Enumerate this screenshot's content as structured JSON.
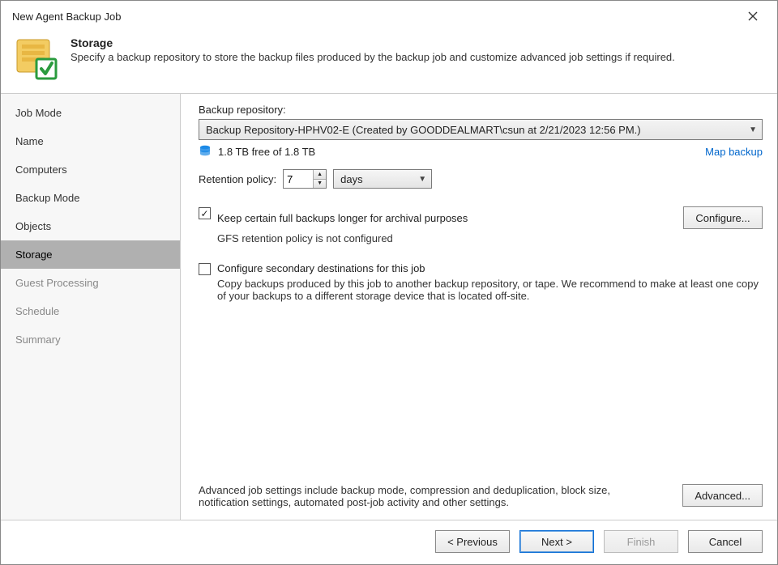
{
  "window": {
    "title": "New Agent Backup Job"
  },
  "header": {
    "title": "Storage",
    "subtitle": "Specify a backup repository to store the backup files produced by the backup job and customize advanced job settings if required."
  },
  "sidebar": {
    "items": [
      {
        "label": "Job Mode",
        "state": "done"
      },
      {
        "label": "Name",
        "state": "done"
      },
      {
        "label": "Computers",
        "state": "done"
      },
      {
        "label": "Backup Mode",
        "state": "done"
      },
      {
        "label": "Objects",
        "state": "done"
      },
      {
        "label": "Storage",
        "state": "active"
      },
      {
        "label": "Guest Processing",
        "state": "pending"
      },
      {
        "label": "Schedule",
        "state": "pending"
      },
      {
        "label": "Summary",
        "state": "pending"
      }
    ]
  },
  "content": {
    "repo_label": "Backup repository:",
    "repo_value": "Backup Repository-HPHV02-E (Created by GOODDEALMART\\csun at 2/21/2023 12:56 PM.)",
    "freespace": "1.8 TB free of 1.8 TB",
    "map_backup": "Map backup",
    "retention_label": "Retention policy:",
    "retention_value": "7",
    "retention_unit": "days",
    "keep_full": {
      "checked": true,
      "label": "Keep certain full backups longer for archival purposes",
      "hint": "GFS retention policy is not configured",
      "configure": "Configure..."
    },
    "secondary": {
      "checked": false,
      "label": "Configure secondary destinations for this job",
      "hint": "Copy backups produced by this job to another backup repository, or tape. We recommend to make at least one copy of your backups to a different storage device that is located off-site."
    },
    "advanced_hint": "Advanced job settings include backup mode, compression and deduplication, block size, notification settings, automated post-job activity and other settings.",
    "advanced_button": "Advanced..."
  },
  "footer": {
    "previous": "< Previous",
    "next": "Next >",
    "finish": "Finish",
    "cancel": "Cancel"
  }
}
